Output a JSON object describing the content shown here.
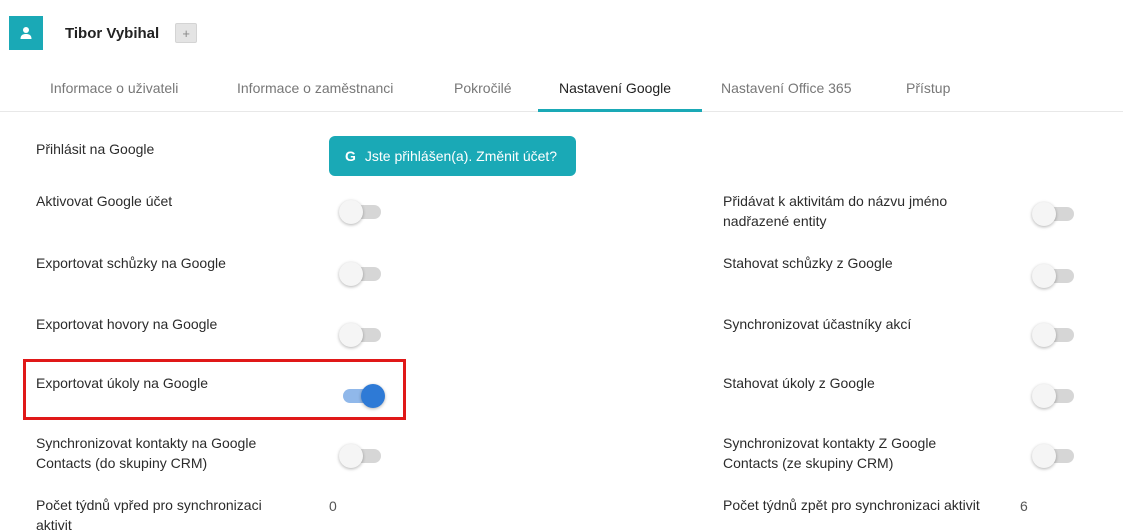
{
  "header": {
    "user_name": "Tibor Vybihal",
    "add_label": "+",
    "avatar_icon": "user-icon"
  },
  "tabs": [
    {
      "label": "Informace o uživateli",
      "active": false
    },
    {
      "label": "Informace o zaměstnanci",
      "active": false
    },
    {
      "label": "Pokročilé",
      "active": false
    },
    {
      "label": "Nastavení Google",
      "active": true
    },
    {
      "label": "Nastavení Office 365",
      "active": false
    },
    {
      "label": "Přístup",
      "active": false
    }
  ],
  "settings": {
    "login_label": "Přihlásit na Google",
    "google_button": {
      "icon": "G",
      "label": "Jste přihlášen(a). Změnit účet?"
    },
    "left": [
      {
        "label": "Aktivovat Google účet",
        "on": false
      },
      {
        "label": "Exportovat schůzky na Google",
        "on": false
      },
      {
        "label": "Exportovat hovory na Google",
        "on": false
      },
      {
        "label": "Exportovat úkoly na Google",
        "on": true
      },
      {
        "label": "Synchronizovat kontakty na Google Contacts (do skupiny CRM)",
        "on": false
      },
      {
        "label": "Počet týdnů vpřed pro synchronizaci aktivit",
        "value": "0"
      }
    ],
    "right": [
      {
        "label": "Přidávat k aktivitám do názvu jméno nadřazené entity",
        "on": false
      },
      {
        "label": "Stahovat schůzky z Google",
        "on": false
      },
      {
        "label": "Synchronizovat účastníky akcí",
        "on": false
      },
      {
        "label": "Stahovat úkoly z Google",
        "on": false
      },
      {
        "label": "Synchronizovat kontakty Z Google Contacts (ze skupiny CRM)",
        "on": false
      },
      {
        "label": "Počet týdnů zpět pro synchronizaci aktivit",
        "value": "6"
      }
    ]
  },
  "colors": {
    "accent": "#1aa9b6",
    "toggle_on": "#2e7ad6",
    "highlight": "#e01818"
  }
}
